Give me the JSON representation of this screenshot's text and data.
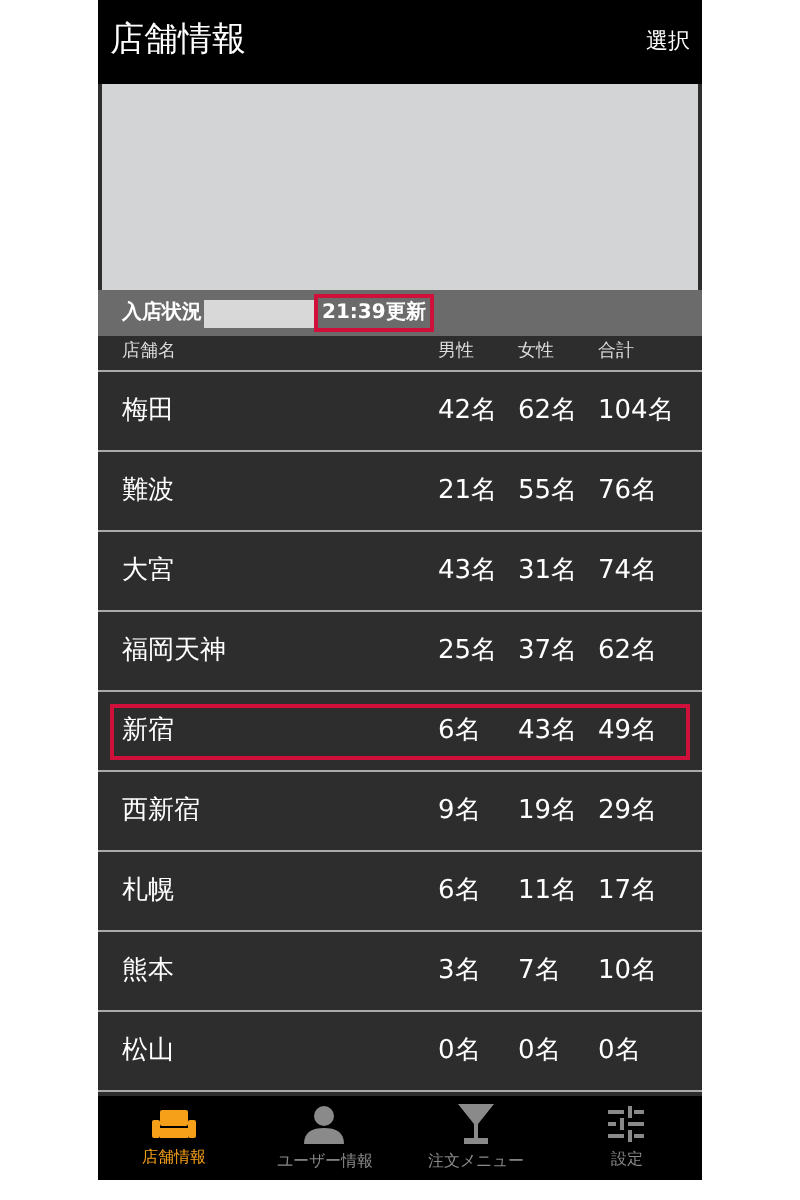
{
  "header": {
    "title": "店舗情報",
    "action": "選択"
  },
  "status": {
    "label": "入店状況",
    "updated": "21:39更新",
    "updated_highlighted": true
  },
  "table": {
    "columns": [
      "店舗名",
      "男性",
      "女性",
      "合計"
    ],
    "rows": [
      {
        "name": "梅田",
        "male": "42名",
        "female": "62名",
        "total": "104名",
        "highlighted": false
      },
      {
        "name": "難波",
        "male": "21名",
        "female": "55名",
        "total": "76名",
        "highlighted": false
      },
      {
        "name": "大宮",
        "male": "43名",
        "female": "31名",
        "total": "74名",
        "highlighted": false
      },
      {
        "name": "福岡天神",
        "male": "25名",
        "female": "37名",
        "total": "62名",
        "highlighted": false
      },
      {
        "name": "新宿",
        "male": "6名",
        "female": "43名",
        "total": "49名",
        "highlighted": true
      },
      {
        "name": "西新宿",
        "male": "9名",
        "female": "19名",
        "total": "29名",
        "highlighted": false
      },
      {
        "name": "札幌",
        "male": "6名",
        "female": "11名",
        "total": "17名",
        "highlighted": false
      },
      {
        "name": "熊本",
        "male": "3名",
        "female": "7名",
        "total": "10名",
        "highlighted": false
      },
      {
        "name": "松山",
        "male": "0名",
        "female": "0名",
        "total": "0名",
        "highlighted": false
      }
    ]
  },
  "tabs": [
    {
      "label": "店舗情報",
      "kind": "sofa",
      "selected": true
    },
    {
      "label": "ユーザー情報",
      "kind": "person",
      "selected": false
    },
    {
      "label": "注文メニュー",
      "kind": "glass",
      "selected": false
    },
    {
      "label": "設定",
      "kind": "sliders",
      "selected": false
    }
  ]
}
